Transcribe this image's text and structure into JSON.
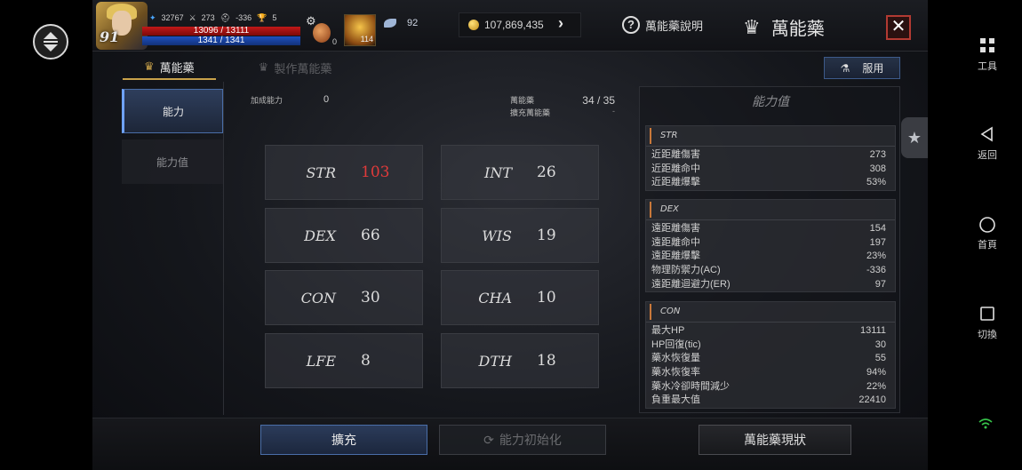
{
  "hud": {
    "level": "91",
    "stats": [
      {
        "icon": "wing-icon",
        "value": "32767"
      },
      {
        "icon": "sword-icon",
        "value": "273"
      },
      {
        "icon": "helmet-icon",
        "value": "-336"
      },
      {
        "icon": "trophy-icon",
        "value": "5"
      }
    ],
    "hp": "13096 / 13111",
    "mp": "1341 / 1341",
    "potion_count": "0",
    "item_count": "114",
    "feather_count": "92",
    "gold": "107,869,435"
  },
  "header": {
    "help_label": "萬能藥說明",
    "title": "萬能藥"
  },
  "tabs": [
    {
      "label": "萬能藥",
      "active": true
    },
    {
      "label": "製作萬能藥",
      "active": false
    }
  ],
  "use_button": "服用",
  "side_tabs": [
    {
      "label": "能力",
      "active": true
    },
    {
      "label": "能力值",
      "active": false
    }
  ],
  "bonus": {
    "label": "加成能力",
    "value": "0"
  },
  "panacea": {
    "label": "萬能藥",
    "value": "34 / 35",
    "expand_label": "擴充萬能藥",
    "expand_value": "-"
  },
  "abilities": [
    {
      "name": "STR",
      "value": "103",
      "highlight": true
    },
    {
      "name": "INT",
      "value": "26"
    },
    {
      "name": "DEX",
      "value": "66"
    },
    {
      "name": "WIS",
      "value": "19"
    },
    {
      "name": "CON",
      "value": "30"
    },
    {
      "name": "CHA",
      "value": "10"
    },
    {
      "name": "LFE",
      "value": "8"
    },
    {
      "name": "DTH",
      "value": "18"
    }
  ],
  "stats_panel": {
    "title": "能力值",
    "groups": [
      {
        "name": "STR",
        "rows": [
          {
            "label": "近距離傷害",
            "value": "273"
          },
          {
            "label": "近距離命中",
            "value": "308"
          },
          {
            "label": "近距離爆擊",
            "value": "53%"
          }
        ]
      },
      {
        "name": "DEX",
        "rows": [
          {
            "label": "遠距離傷害",
            "value": "154"
          },
          {
            "label": "遠距離命中",
            "value": "197"
          },
          {
            "label": "遠距離爆擊",
            "value": "23%"
          },
          {
            "label": "物理防禦力(AC)",
            "value": "-336"
          },
          {
            "label": "遠距離迴避力(ER)",
            "value": "97"
          }
        ]
      },
      {
        "name": "CON",
        "rows": [
          {
            "label": "最大HP",
            "value": "13111"
          },
          {
            "label": "HP回復(tic)",
            "value": "30"
          },
          {
            "label": "藥水恢復量",
            "value": "55"
          },
          {
            "label": "藥水恢復率",
            "value": "94%"
          },
          {
            "label": "藥水冷卻時間減少",
            "value": "22%"
          },
          {
            "label": "負重最大值",
            "value": "22410"
          }
        ]
      }
    ]
  },
  "bottom": {
    "expand": "擴充",
    "reset": "能力初始化",
    "status": "萬能藥現狀"
  },
  "android_nav": [
    {
      "label": "工具",
      "icon": "grid-icon"
    },
    {
      "label": "返回",
      "icon": "back-icon"
    },
    {
      "label": "首頁",
      "icon": "home-icon"
    },
    {
      "label": "切換",
      "icon": "recent-apps-icon"
    }
  ],
  "colors": {
    "accent_blue": "#4a6ea8",
    "highlight_red": "#e03a3a",
    "gold": "#c9a24a"
  }
}
